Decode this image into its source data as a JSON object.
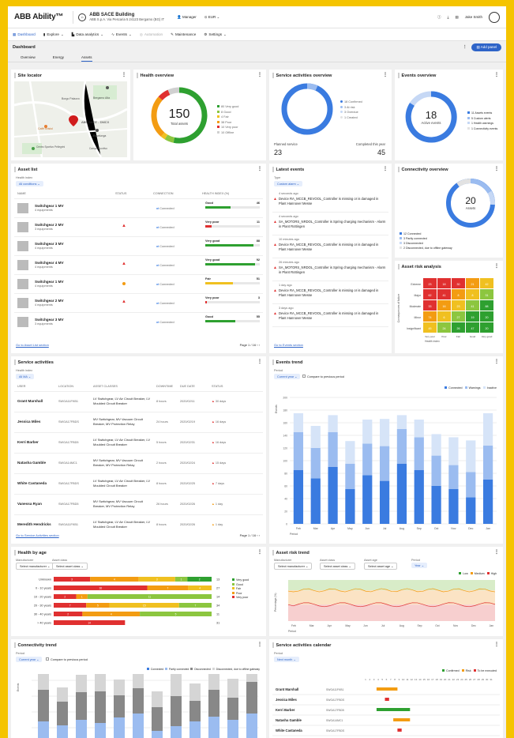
{
  "app": {
    "logo": "ABB Ability™",
    "building": "ABB SACE Building",
    "address": "ABB S.p.A. Via Pescaria 5 24123 Bergamo (BG) IT",
    "role": "Manager",
    "language": "EUR",
    "user": "Jake Smith"
  },
  "nav": [
    "Dashboard",
    "Explore",
    "Data analytics",
    "Events",
    "Automation",
    "Maintenance",
    "Settings"
  ],
  "dashboard": {
    "title": "Dashboard",
    "add_panel": "Add panel",
    "tabs": [
      "Overview",
      "Energy",
      "Assets"
    ]
  },
  "site_locator": {
    "title": "Site locator",
    "pins": [
      "Bergamo",
      "Gianluca",
      "Ospedale",
      "Mixed"
    ],
    "labels": [
      "Bergamo Alta",
      "Borgo Palazzo",
      "Caffè Bristol",
      "ABB SACE - DMCX",
      "Esselunga",
      "Centro Sportivo Pellegrini",
      "Campo Sportivo"
    ]
  },
  "health": {
    "title": "Health overview",
    "total": "150",
    "total_label": "Total assets",
    "legend": [
      "80 Very good",
      "8 Good",
      "4 Fair",
      "38 Poor",
      "10 Very poor",
      "10 Offline"
    ],
    "colors": [
      "#2ea030",
      "#8cc63f",
      "#f0c020",
      "#f39c12",
      "#e03030",
      "#d0d0d0"
    ],
    "values": [
      80,
      8,
      4,
      38,
      10,
      10
    ]
  },
  "service_overview": {
    "title": "Service activities overview",
    "legend": [
      "18 Confirmed",
      "3 At risk",
      "3 Overdue",
      "1 Created"
    ],
    "planned_label": "Planned service",
    "planned": "23",
    "completed_label": "Completed this year",
    "completed": "45"
  },
  "events_overview": {
    "title": "Events overview",
    "count": "18",
    "count_label": "Active events",
    "legend": [
      "11 Assets events",
      "5 Custom alerts",
      "1 Health warnings",
      "1 Connectivity events"
    ]
  },
  "asset_list": {
    "title": "Asset list",
    "filter_label": "Health index",
    "filter": "All conditions",
    "headers": [
      "NAME",
      "STATUS",
      "CONNECTION",
      "HEALTH INDEX (%)"
    ],
    "rows": [
      {
        "name": "Switchgear 1 MV",
        "sub": "4 equipments",
        "status": "",
        "conn": "Connected",
        "health": "Good",
        "val": "46",
        "color": "#2ea030",
        "pct": 0.46
      },
      {
        "name": "Switchgear 2 MV",
        "sub": "3 equipments",
        "status": "warn",
        "conn": "Connected",
        "health": "Very poor",
        "val": "11",
        "color": "#e03030",
        "pct": 0.11
      },
      {
        "name": "Switchgear 3 MV",
        "sub": "4 equipments",
        "status": "",
        "conn": "Connected",
        "health": "Very good",
        "val": "88",
        "color": "#2ea030",
        "pct": 0.88
      },
      {
        "name": "Switchgear 4 MV",
        "sub": "4 equipments",
        "status": "warn",
        "conn": "Connected",
        "health": "Very good",
        "val": "92",
        "color": "#2ea030",
        "pct": 0.92
      },
      {
        "name": "Switchgear 1 MV",
        "sub": "4 equipments",
        "status": "info",
        "conn": "Connected",
        "health": "Fair",
        "val": "51",
        "color": "#f0c020",
        "pct": 0.51
      },
      {
        "name": "Switchgear 2 MV",
        "sub": "4 equipments",
        "status": "warn",
        "conn": "Connected",
        "health": "Very poor",
        "val": "3",
        "color": "#e03030",
        "pct": 0.03
      },
      {
        "name": "Switchgear 3 MV",
        "sub": "3 equipments",
        "status": "",
        "conn": "Connected",
        "health": "Good",
        "val": "55",
        "color": "#2ea030",
        "pct": 0.55
      }
    ],
    "footer_link": "Go to Asset List section",
    "page": "Page  1 / 16"
  },
  "latest_events": {
    "title": "Latest events",
    "filter_label": "Type",
    "filter": "Custom alarm",
    "items": [
      {
        "time": "4 seconds ago",
        "text": "Device RA_MCCB_REVOOL_Controller is missing or is damaged in Plant Hannover Messe"
      },
      {
        "time": "4 seconds ago",
        "text": "SA_MOTORS_NRDOL_Controller is Spring charging mechanism - Alarm in Plant Rottingen"
      },
      {
        "time": "10 minutes ago",
        "text": "Device RA_MCCB_REVOOL_Controller is missing or is damaged in Plant Hannover Messe"
      },
      {
        "time": "26 minutes ago",
        "text": "SA_MOTORS_NRDOL_Controller is Spring charging mechanism - Alarm in Plant Rottingen"
      },
      {
        "time": "1 day ago",
        "text": "Device RA_MCCB_REVOOL_Controller is missing or is damaged in Plant Hannover Messe"
      },
      {
        "time": "3 days ago",
        "text": "Device RA_MCCB_REVOOL_Controller is missing or is damaged in Plant Hannover Messe"
      }
    ],
    "footer_link": "Go to Events section"
  },
  "connectivity_overview": {
    "title": "Connectivity overview",
    "count": "20",
    "count_label": "Assets",
    "legend": [
      "12 Connected",
      "3 Partly connected",
      "3 Disconnected",
      "2 Disconnected, due to offline gateway"
    ]
  },
  "risk_analysis": {
    "title": "Asset risk analysis",
    "ylabel": "Consequences of failure",
    "xlabel": "Health index",
    "rows": [
      "Extreme",
      "Major",
      "Moderate",
      "Minor",
      "Insignificant"
    ],
    "cols": [
      "Very poor",
      "Poor",
      "Fair",
      "Good",
      "Very good"
    ],
    "cells": [
      [
        "23",
        "18",
        "30",
        "21",
        "42"
      ],
      [
        "62",
        "41",
        "8",
        "8",
        "31"
      ],
      [
        "33",
        "16",
        "23",
        "41",
        "88"
      ],
      [
        "74",
        "6",
        "27",
        "19",
        "20"
      ],
      [
        "45",
        "24",
        "26",
        "47",
        "20"
      ]
    ],
    "colors": [
      [
        "#e03030",
        "#e03030",
        "#e03030",
        "#f39c12",
        "#f0c020"
      ],
      [
        "#e03030",
        "#e03030",
        "#f39c12",
        "#f0c020",
        "#8cc63f"
      ],
      [
        "#e03030",
        "#f39c12",
        "#f0c020",
        "#8cc63f",
        "#2ea030"
      ],
      [
        "#f39c12",
        "#f0c020",
        "#8cc63f",
        "#2ea030",
        "#2ea030"
      ],
      [
        "#f0c020",
        "#8cc63f",
        "#2ea030",
        "#2ea030",
        "#2ea030"
      ]
    ]
  },
  "service_activities": {
    "title": "Service activities",
    "filter_label": "Health index",
    "filter": "All MA",
    "headers": [
      "USER",
      "LOCATION",
      "ASSET CLASSES",
      "DOWNTIME",
      "DUE DATE",
      "STATUS"
    ],
    "rows": [
      {
        "user": "Grant Marshall",
        "loc": "SWGA11FKB1",
        "asset": "LV Switchgear, LV Air Circuit Breaker, LV Moulded Circuit Breaker",
        "down": "8 hours",
        "due": "2020/02/11",
        "status": "30 days",
        "sc": "#e03030"
      },
      {
        "user": "Jessica Miles",
        "loc": "SWGA17FBDS",
        "asset": "MV Switchgear, MV Vacuum Circuit Breaker, MV Protection Relay",
        "down": "24 hours",
        "due": "2020/02/19",
        "status": "16 days",
        "sc": "#e03030"
      },
      {
        "user": "Kerri Barber",
        "loc": "SWGA17FBD5",
        "asset": "LV Switchgear, LV Air Circuit Breaker, LV Moulded Circuit Breaker",
        "down": "5 hours",
        "due": "2020/02/31",
        "status": "16 days",
        "sc": "#e03030"
      },
      {
        "user": "Natasha Gamble",
        "loc": "SWGA14MC1",
        "asset": "MV Switchgear, MV Vacuum Circuit Breaker, MV Protection Relay",
        "down": "2 hours",
        "due": "2020/02/24",
        "status": "15 days",
        "sc": "#e03030"
      },
      {
        "user": "White Castaneda",
        "loc": "SWGA17FBDS",
        "asset": "LV Switchgear, LV Air Circuit Breaker, LV Moulded Circuit Breaker",
        "down": "8 hours",
        "due": "2020/02/25",
        "status": "7 days",
        "sc": "#e03030"
      },
      {
        "user": "Vanessa Ryan",
        "loc": "SWGA17FBD5",
        "asset": "MV Switchgear, MV Vacuum Circuit Breaker, MV Protection Relay",
        "down": "26 hours",
        "due": "2020/02/26",
        "status": "1 day",
        "sc": "#f39c12"
      },
      {
        "user": "Meredith Hendricks",
        "loc": "SWGA11FKB1",
        "asset": "LV Switchgear, LV Air Circuit Breaker, LV Moulded Circuit Breaker",
        "down": "8 hours",
        "due": "2020/02/26",
        "status": "1 day",
        "sc": "#f39c12"
      }
    ],
    "footer_link": "Go to Service Activities section",
    "page": "Page  1 / 16"
  },
  "events_trend": {
    "title": "Events trend",
    "filter_label": "Period",
    "filter": "Current year",
    "compare": "Compare to previous period",
    "legend": [
      "Connected",
      "Warnings",
      "Inactive"
    ],
    "ylabel": "Events",
    "xlabel": "Period"
  },
  "chart_data": [
    {
      "type": "bar",
      "title": "Events trend",
      "xlabel": "Period",
      "ylabel": "Events",
      "categories": [
        "Feb",
        "Mar",
        "Apr",
        "May",
        "Jun",
        "Jul",
        "Aug",
        "Sep",
        "Oct",
        "Nov",
        "Dec",
        "Jan"
      ],
      "ylim": [
        0,
        200
      ],
      "stacked": true,
      "series": [
        {
          "name": "Connected",
          "values": [
            85,
            72,
            90,
            55,
            77,
            68,
            95,
            85,
            60,
            55,
            42,
            70
          ]
        },
        {
          "name": "Warnings",
          "values": [
            60,
            48,
            55,
            40,
            50,
            55,
            55,
            52,
            48,
            38,
            40,
            54
          ]
        },
        {
          "name": "Inactive",
          "values": [
            30,
            35,
            27,
            36,
            38,
            43,
            22,
            28,
            34,
            44,
            50,
            51
          ]
        }
      ]
    },
    {
      "type": "bar",
      "title": "Health by age",
      "orientation": "horizontal",
      "categories": [
        "Unknown",
        "0 - 10 years",
        "10 - 20 years",
        "20 - 30 years",
        "30 - 40 years",
        "> 40 years"
      ],
      "series": [
        {
          "name": "Very good",
          "values": [
            2,
            0,
            0,
            0,
            0,
            0
          ]
        },
        {
          "name": "Good",
          "values": [
            1,
            0,
            11,
            7,
            5,
            0
          ]
        },
        {
          "name": "Fair",
          "values": [
            3,
            4,
            0,
            15,
            0,
            0
          ]
        },
        {
          "name": "Poor",
          "values": [
            4,
            7,
            1,
            5,
            4,
            0
          ]
        },
        {
          "name": "Very poor",
          "values": [
            3,
            16,
            2,
            7,
            2,
            14
          ]
        }
      ],
      "totals": [
        13,
        27,
        14,
        34,
        11,
        31
      ]
    },
    {
      "type": "area",
      "title": "Asset risk trend",
      "xlabel": "Period",
      "ylabel": "Percentage (%)",
      "categories": [
        "Feb",
        "Mar",
        "Apr",
        "May",
        "Jun",
        "Jul",
        "Aug",
        "Sep",
        "Oct",
        "Nov",
        "Dec",
        "Jan"
      ],
      "legend": [
        "Low",
        "Medium",
        "High"
      ]
    },
    {
      "type": "bar",
      "title": "Connectivity trend",
      "ylabel": "Events",
      "stacked": true,
      "legend": [
        "Connected",
        "Partly connected",
        "Disconnected",
        "Disconnected, due to offline gateway"
      ]
    }
  ],
  "health_by_age": {
    "title": "Health by age",
    "f1_label": "Manufacturer",
    "f1": "Select manufacturer",
    "f2_label": "Asset class",
    "f2": "Select asset class",
    "legend": [
      "Very good",
      "Good",
      "Fair",
      "Poor",
      "Very poor"
    ],
    "legend_colors": [
      "#2ea030",
      "#8cc63f",
      "#f0c020",
      "#f39c12",
      "#e03030"
    ]
  },
  "risk_trend": {
    "title": "Asset risk trend",
    "f1_label": "Manufacturer",
    "f1": "Select manufacturer",
    "f2_label": "Asset class",
    "f2": "Select asset class",
    "f3_label": "Asset age",
    "f3": "Select asset age",
    "f4_label": "Period",
    "f4": "Year",
    "legend": [
      "Low",
      "Medium",
      "High"
    ]
  },
  "connectivity_trend": {
    "title": "Connectivity trend",
    "filter_label": "Period",
    "filter": "Current year",
    "compare": "Compare to previous period",
    "legend": [
      "Connected",
      "Partly connected",
      "Disconnected",
      "Disconnected, due to offline gateway"
    ]
  },
  "calendar": {
    "title": "Service activities calendar",
    "filter_label": "Period",
    "filter": "Next month",
    "legend": [
      "Confirmed",
      "Risk",
      "To be executed"
    ],
    "rows": [
      {
        "user": "Grant Marshall",
        "loc": "SWGA11FKB1"
      },
      {
        "user": "Jessica Miles",
        "loc": "SWGA17FBDS"
      },
      {
        "user": "Kerri Barber",
        "loc": "SWGA17FBD5"
      },
      {
        "user": "Natasha Gamble",
        "loc": "SWGA14MC1"
      },
      {
        "user": "White Castaneda",
        "loc": "SWGA17FBDS"
      }
    ],
    "days": [
      "1",
      "2",
      "3",
      "4",
      "5",
      "6",
      "7",
      "8",
      "9",
      "10",
      "11",
      "12",
      "13",
      "14",
      "15",
      "16",
      "17",
      "18",
      "19",
      "20",
      "21",
      "22",
      "23",
      "24",
      "25",
      "26",
      "27",
      "28",
      "29",
      "30",
      "31"
    ]
  }
}
